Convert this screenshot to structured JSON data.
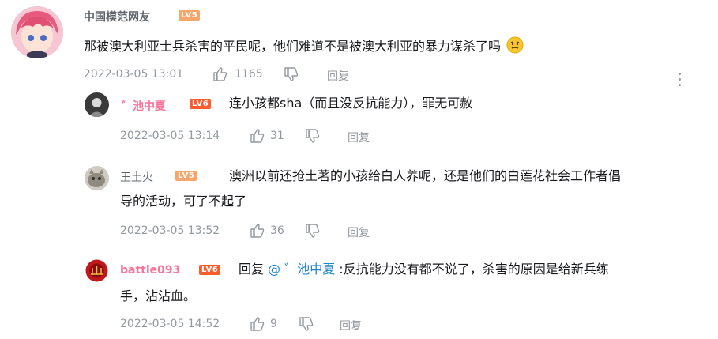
{
  "main_comment": {
    "username": "中国模范网友",
    "level": "LV5",
    "text": "那被澳大利亚士兵杀害的平民呢，他们难道不是被澳大利亚的暴力谋杀了吗",
    "emoji": "thinking-emoji",
    "time": "2022-03-05 13:01",
    "likes": "1165",
    "reply_label": "回复"
  },
  "replies": [
    {
      "username": "゛池中夏",
      "level": "LV6",
      "text": "连小孩都sha（而且没反抗能力），罪无可赦",
      "time": "2022-03-05 13:14",
      "likes": "31",
      "reply_label": "回复"
    },
    {
      "username": "王土火",
      "level": "LV5",
      "text_line1": "澳洲以前还抢土著的小孩给白人养呢，还是他们的白莲花社会工作者倡",
      "text_line2": "导的活动，可了不起了",
      "time": "2022-03-05 13:52",
      "likes": "36",
      "reply_label": "回复"
    },
    {
      "username": "battle093",
      "level": "LV6",
      "reply_prefix": "回复",
      "mention": "@ ゛池中夏",
      "text_line1": ":反抗能力没有都不说了，杀害的原因是给新兵练",
      "text_line2": "手，沾沾血。",
      "time": "2022-03-05 14:52",
      "likes": "9",
      "reply_label": "回复"
    }
  ],
  "colors": {
    "lv5": "#f5a66a",
    "lv6": "#ff5c2d",
    "pink_name": "#fb7299",
    "meta": "#9499a0",
    "link": "#1e87c8"
  }
}
